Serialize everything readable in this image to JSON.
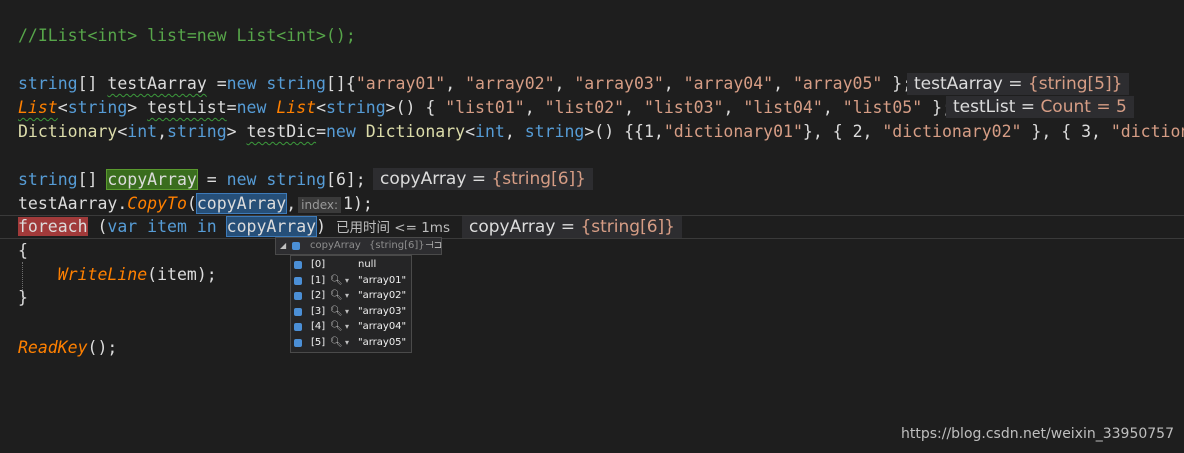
{
  "code": {
    "comment_line": "//IList<int> list=new List<int>();",
    "line_array": {
      "kw1": "string",
      "p1": "[] ",
      "var": "testAarray",
      "p2": " =",
      "kw2": "new",
      "p3": " ",
      "kw3": "string",
      "p4": "[]{",
      "s1": "\"array01\"",
      "s2": "\"array02\"",
      "s3": "\"array03\"",
      "s4": "\"array04\"",
      "s5": "\"array05\"",
      "end": " };"
    },
    "line_list": {
      "t1": "List",
      "kw1": "string",
      "var": "testList",
      "kw2": "new",
      "t2": "List",
      "kw3": "string",
      "s1": "\"list01\"",
      "s2": "\"list02\"",
      "s3": "\"list03\"",
      "s4": "\"list04\"",
      "s5": "\"list05\"",
      "end": " };"
    },
    "line_dict": {
      "t1": "Dictionary",
      "kw1": "int",
      "kw2": "string",
      "var": "testDic",
      "kw3": "new",
      "t2": "Dictionary",
      "kw4": "int",
      "kw5": "string",
      "n1": "1",
      "s1": "\"dictionary01\"",
      "n2": "2",
      "s2": "\"dictionary02\"",
      "n3": "3",
      "s3": "\"dictionar"
    },
    "line_copy": {
      "kw1": "string",
      "var": "copyArray",
      "kw2": "new",
      "kw3": "string",
      "size": "6"
    },
    "line_copyto": {
      "obj": "testAarray",
      "method": "CopyTo",
      "arg": "copyArray",
      "hint": "index:",
      "num": "1"
    },
    "line_foreach": {
      "kw1": "foreach",
      "kw2": "var",
      "var": "item",
      "kw3": "in",
      "coll": "copyArray"
    },
    "open_brace": "{",
    "writeline": "WriteLine",
    "writeline_arg": "item",
    "close_brace": "}",
    "readkey": "ReadKey"
  },
  "datatips": {
    "array": {
      "name": "testAarray",
      "eq": " = ",
      "value": "{string[5]}"
    },
    "list": {
      "name": "testList",
      "eq": " = ",
      "value": "Count = 5"
    },
    "copy": {
      "name": "copyArray",
      "eq": " = ",
      "value": "{string[6]}"
    },
    "foreach": {
      "name": "copyArray",
      "eq": " = ",
      "value": "{string[6]}"
    }
  },
  "perf_tip": "已用时间 <= 1ms",
  "popup": {
    "name": "copyArray",
    "type": "{string[6]}",
    "pin": "⊣⊐",
    "items": [
      {
        "index": "[0]",
        "value": "null"
      },
      {
        "index": "[1]",
        "value": "\"array01\""
      },
      {
        "index": "[2]",
        "value": "\"array02\""
      },
      {
        "index": "[3]",
        "value": "\"array03\""
      },
      {
        "index": "[4]",
        "value": "\"array04\""
      },
      {
        "index": "[5]",
        "value": "\"array05\""
      }
    ]
  },
  "watermark": "https://blog.csdn.net/weixin_33950757",
  "colors": {
    "background": "#1e1e1e",
    "keyword": "#569cd6",
    "type": "#4ec9b0",
    "string": "#d69d85",
    "comment": "#57a64a",
    "method": "#ff8000"
  },
  "icons": [
    "expand-triangle-icon",
    "variable-icon",
    "pin-icon",
    "magnifier-icon",
    "dropdown-arrow-icon"
  ]
}
